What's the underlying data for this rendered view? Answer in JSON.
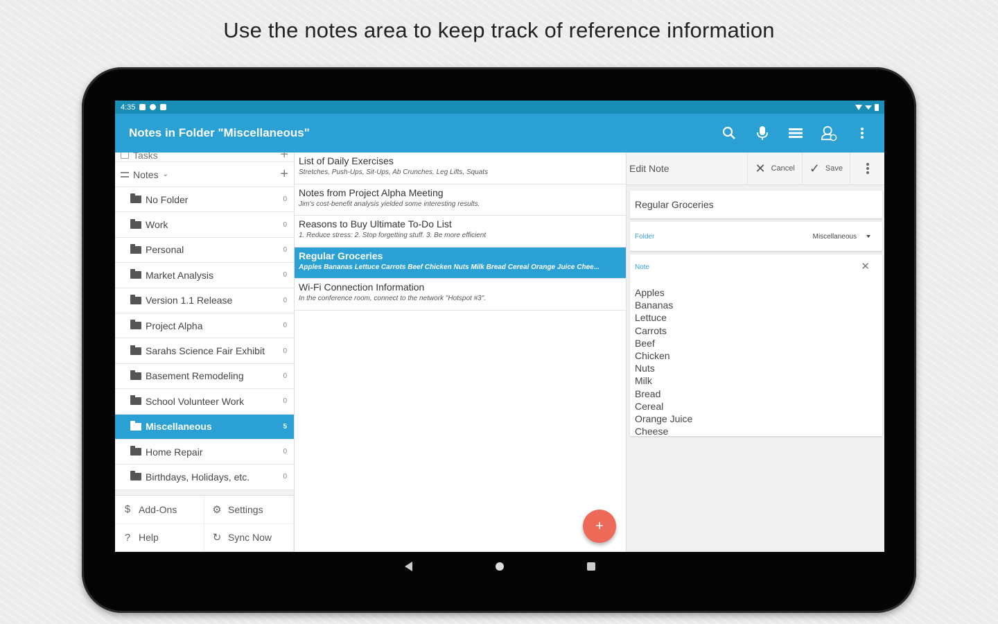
{
  "caption": "Use the notes area to keep track of reference information",
  "status": {
    "time": "4:35"
  },
  "appbar": {
    "title": "Notes in Folder \"Miscellaneous\"",
    "icons": [
      "search-icon",
      "microphone-icon",
      "list-icon",
      "sync-account-icon",
      "more-vert-icon"
    ]
  },
  "sidebar": {
    "tasks_label": "Tasks",
    "notes_label": "Notes",
    "folders": [
      {
        "name": "No Folder",
        "count": "0"
      },
      {
        "name": "Work",
        "count": "0"
      },
      {
        "name": "Personal",
        "count": "0"
      },
      {
        "name": "Market Analysis",
        "count": "0"
      },
      {
        "name": "Version 1.1 Release",
        "count": "0"
      },
      {
        "name": "Project Alpha",
        "count": "0"
      },
      {
        "name": "Sarahs Science Fair Exhibit",
        "count": "0"
      },
      {
        "name": "Basement Remodeling",
        "count": "0"
      },
      {
        "name": "School Volunteer Work",
        "count": "0"
      },
      {
        "name": "Miscellaneous",
        "count": "5"
      },
      {
        "name": "Home Repair",
        "count": "0"
      },
      {
        "name": "Birthdays, Holidays, etc.",
        "count": "0"
      }
    ],
    "footer": {
      "addons": "Add-Ons",
      "settings": "Settings",
      "help": "Help",
      "sync": "Sync Now"
    }
  },
  "notes": [
    {
      "title": "List of Daily Exercises",
      "snippet": "Stretches, Push-Ups, Sit-Ups, Ab Crunches, Leg Lifts, Squats"
    },
    {
      "title": "Notes from Project Alpha Meeting",
      "snippet": "Jim's cost-benefit analysis yielded some interesting results."
    },
    {
      "title": "Reasons to Buy Ultimate To-Do List",
      "snippet": "1. Reduce stress: 2. Stop forgetting stuff. 3. Be more efficient"
    },
    {
      "title": "Regular Groceries",
      "snippet": "Apples Bananas Lettuce Carrots Beef Chicken Nuts Milk Bread Cereal Orange Juice Chee..."
    },
    {
      "title": "Wi-Fi Connection Information",
      "snippet": "In the conference room, connect to the network \"Hotspot #3\"."
    }
  ],
  "editor": {
    "header": "Edit Note",
    "cancel": "Cancel",
    "save": "Save",
    "title_value": "Regular Groceries",
    "folder_label": "Folder",
    "folder_value": "Miscellaneous",
    "note_label": "Note",
    "note_lines": [
      "Apples",
      "Bananas",
      "Lettuce",
      "Carrots",
      "Beef",
      "Chicken",
      "Nuts",
      "Milk",
      "Bread",
      "Cereal",
      "Orange Juice",
      "Cheese"
    ]
  },
  "fab_label": "+",
  "colors": {
    "accent": "#2aa0d4",
    "status_bar": "#1a8db6",
    "fab": "#ee6a58"
  }
}
